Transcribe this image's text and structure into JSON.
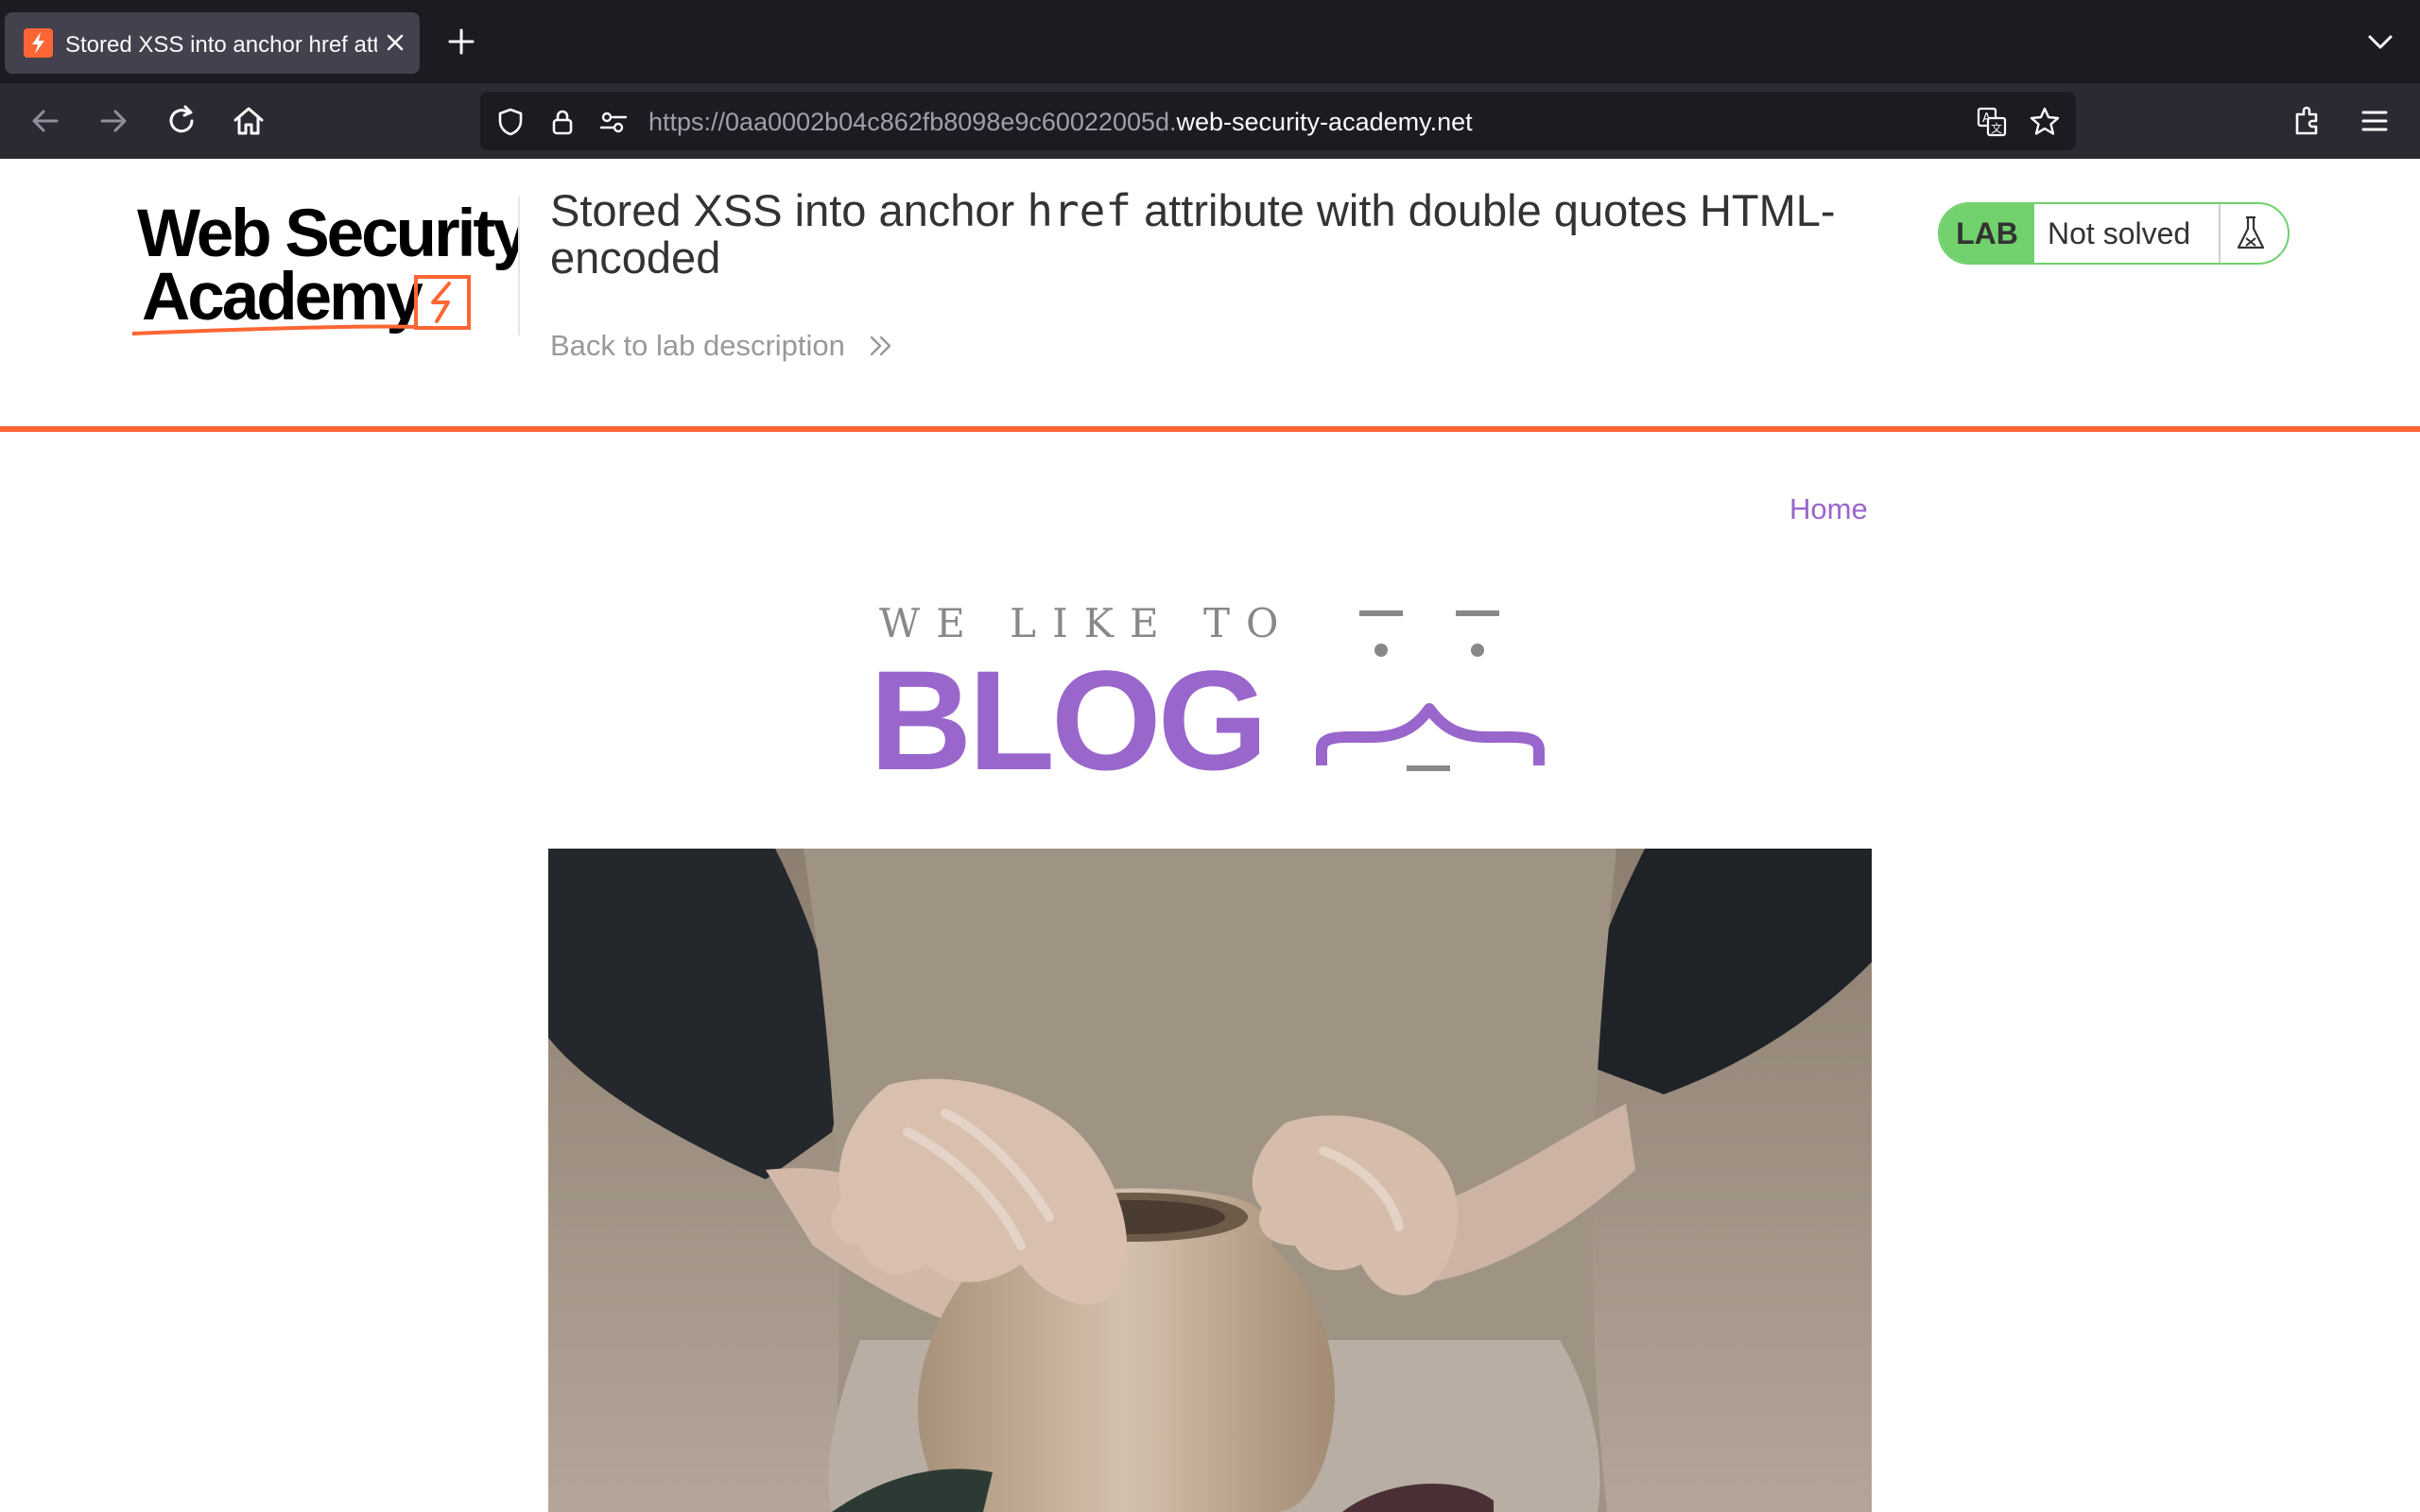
{
  "browser": {
    "tab_title": "Stored XSS into anchor href attr",
    "url_scheme": "https://0aa0002b04c862fb8098e9c60022005d.",
    "url_host": "web-security-academy.net"
  },
  "lab": {
    "logo_alt": "Web Security Academy",
    "title_pre": "Stored XSS into anchor ",
    "title_code": "href",
    "title_post": " attribute with double quotes HTML-encoded",
    "back_link": "Back to lab description",
    "status_label": "LAB",
    "status_value": "Not solved",
    "colors": {
      "accent": "#ff6633",
      "solved_green": "#70d16d"
    }
  },
  "blog": {
    "home_link": "Home",
    "logo_tagline": "WE LIKE TO",
    "logo_word": "BLOG",
    "accent_color": "#9966cc",
    "photo_subject": "hands shaping a clay pot on a pottery wheel"
  }
}
